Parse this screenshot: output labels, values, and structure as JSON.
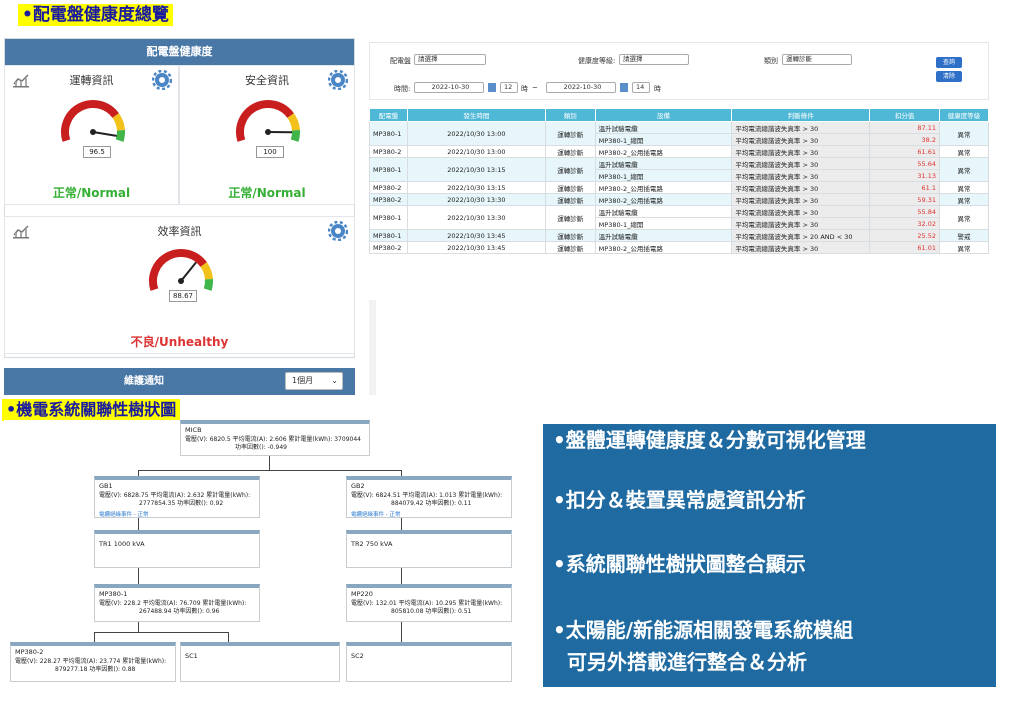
{
  "top_title": "•配電盤健康度總覽",
  "health_panel": {
    "header": "配電盤健康度",
    "cards": [
      {
        "title": "運轉資訊",
        "value": "96.5",
        "status": "正常/Normal",
        "state": "ok",
        "gauge_fraction": 0.96
      },
      {
        "title": "安全資訊",
        "value": "100",
        "status": "正常/Normal",
        "state": "ok",
        "gauge_fraction": 0.92
      },
      {
        "title": "效率資訊",
        "value": "88.67",
        "status": "不良/Unhealthy",
        "state": "bad",
        "gauge_fraction": 0.68
      }
    ]
  },
  "notify": {
    "label": "維護通知",
    "select_value": "1個月"
  },
  "filter": {
    "panel_label": "配電盤",
    "panel_select": "請選擇",
    "grade_label": "健康度等級:",
    "grade_select": "請選擇",
    "type_label": "類別",
    "type_select": "運轉診斷",
    "time_label": "時間:",
    "date_from": "2022-10-30",
    "hour_from": "12",
    "hour_unit_1": "時",
    "tilde": "~",
    "date_to": "2022-10-30",
    "hour_to": "14",
    "hour_unit_2": "時",
    "query_button": "查詢",
    "clear_button": "清除"
  },
  "table": {
    "headers": [
      "配電盤",
      "發生時間",
      "類別",
      "設備",
      "判斷條件",
      "扣分值",
      "健康度等級"
    ],
    "groups": [
      {
        "panel": "MP380-1",
        "time": "2022/10/30 13:00",
        "type": "運轉診斷",
        "alt": true,
        "grade": "異常",
        "rows": [
          {
            "device": "溫升試驗電纜",
            "cond": "平均電流總諧波失真率 > 30",
            "score": "87.11"
          },
          {
            "device": "MP380-1_總開",
            "cond": "平均電流總諧波失真率 > 30",
            "score": "38.2"
          }
        ]
      },
      {
        "panel": "MP380-2",
        "time": "2022/10/30 13:00",
        "type": "運轉診斷",
        "alt": false,
        "grade": "異常",
        "rows": [
          {
            "device": "MP380-2_公用插電路",
            "cond": "平均電流總諧波失真率 > 30",
            "score": "61.61"
          }
        ]
      },
      {
        "panel": "MP380-1",
        "time": "2022/10/30 13:15",
        "type": "運轉診斷",
        "alt": true,
        "grade": "異常",
        "rows": [
          {
            "device": "溫升試驗電纜",
            "cond": "平均電流總諧波失真率 > 30",
            "score": "55.64"
          },
          {
            "device": "MP380-1_總開",
            "cond": "平均電流總諧波失真率 > 30",
            "score": "31.13"
          }
        ]
      },
      {
        "panel": "MP380-2",
        "time": "2022/10/30 13:15",
        "type": "運轉診斷",
        "alt": false,
        "grade": "異常",
        "rows": [
          {
            "device": "MP380-2_公用插電路",
            "cond": "平均電流總諧波失真率 > 30",
            "score": "61.1"
          }
        ]
      },
      {
        "panel": "MP380-2",
        "time": "2022/10/30 13:30",
        "type": "運轉診斷",
        "alt": true,
        "grade": "異常",
        "rows": [
          {
            "device": "MP380-2_公用插電路",
            "cond": "平均電流總諧波失真率 > 30",
            "score": "59.31"
          }
        ]
      },
      {
        "panel": "MP380-1",
        "time": "2022/10/30 13:30",
        "type": "運轉診斷",
        "alt": false,
        "grade": "異常",
        "rows": [
          {
            "device": "溫升試驗電纜",
            "cond": "平均電流總諧波失真率 > 30",
            "score": "55.84"
          },
          {
            "device": "MP380-1_總開",
            "cond": "平均電流總諧波失真率 > 30",
            "score": "32.02"
          }
        ]
      },
      {
        "panel": "MP380-1",
        "time": "2022/10/30 13:45",
        "type": "運轉診斷",
        "alt": true,
        "grade": "警戒",
        "rows": [
          {
            "device": "溫升試驗電纜",
            "cond": "平均電流總諧波失真率 > 20 AND < 30",
            "score": "25.52"
          }
        ]
      },
      {
        "panel": "MP380-2",
        "time": "2022/10/30 13:45",
        "type": "運轉診斷",
        "alt": false,
        "grade": "異常",
        "rows": [
          {
            "device": "MP380-2_公用插電路",
            "cond": "平均電流總諧波失真率 > 30",
            "score": "61.01"
          }
        ]
      }
    ]
  },
  "tree_title": "•機電系統關聯性樹狀圖",
  "tree": {
    "micb": {
      "name": "MICB",
      "l1": "電壓(V): 6820.5  平均電流(A): 2.606  累計電量(kWh): 3709044",
      "l2": "功率因數(): -0.949"
    },
    "gb1": {
      "name": "GB1",
      "l1": "電壓(V): 6828.75  平均電流(A): 2.632  累計電量(kWh):",
      "l2": "2777854.35  功率因數(): 0.92",
      "link": "電纜絕緣事件 - 正常"
    },
    "gb2": {
      "name": "GB2",
      "l1": "電壓(V): 6824.51  平均電流(A): 1.013  累計電量(kWh):",
      "l2": "884079.42  功率因數(): 0.11",
      "link": "電纜絕緣事件 - 正常"
    },
    "tr1": {
      "name": "TR1 1000 kVA"
    },
    "tr2": {
      "name": "TR2 750 kVA"
    },
    "mp3801": {
      "name": "MP380-1",
      "l1": "電壓(V): 228.2  平均電流(A): 76.709  累計電量(kWh):",
      "l2": "267488.94  功率因數(): 0.96"
    },
    "mp220": {
      "name": "MP220",
      "l1": "電壓(V): 132.01  平均電流(A): 10.295  累計電量(kWh):",
      "l2": "805810.08  功率因數(): 0.51"
    },
    "mp3802": {
      "name": "MP380-2",
      "l1": "電壓(V): 228.27  平均電流(A): 23.774  累計電量(kWh):",
      "l2": "879277.18  功率因數(): 0.88"
    },
    "sc1": {
      "name": "SC1"
    },
    "sc2": {
      "name": "SC2"
    }
  },
  "bullets": [
    "•盤體運轉健康度＆分數可視化管理",
    "•扣分＆裝置異常處資訊分析",
    "•系統關聯性樹狀圖整合顯示",
    "•太陽能/新能源相關發電系統模組",
    "可另外搭載進行整合＆分析"
  ],
  "colors": {
    "header": "#4a78a6",
    "table_header": "#4fb8d6",
    "ok": "#35b035",
    "bad": "#dd3333",
    "bullet_bg": "#1f6aa0"
  }
}
